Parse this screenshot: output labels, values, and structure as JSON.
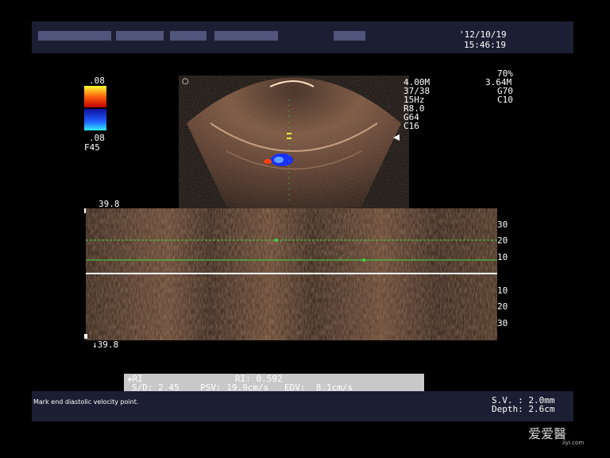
{
  "header": {
    "date": "'12/10/19",
    "time": "15:46:19",
    "redacted_label": "patient info (blurred)"
  },
  "color_scale": {
    "top": ".08",
    "bottom": ".08",
    "filter": "F45"
  },
  "params_left": {
    "freq": "4.00M",
    "gain_ratio": "37/38",
    "prf": "15Hz",
    "r": "R8.0",
    "g": "G64",
    "c": "C16"
  },
  "params_right": {
    "power": "70%",
    "freq": "3.64M",
    "gain": "G70",
    "c": "C10"
  },
  "spectral": {
    "top_scale": "39.8",
    "bottom_scale": "↓39.8",
    "ticks_top": [
      "30",
      "20",
      "10"
    ],
    "ticks_bottom": [
      "10",
      "20",
      "30"
    ]
  },
  "measurements": {
    "line1_left": "✚RI",
    "line1_right": "RI: 0.592",
    "line2": "S/D: 2.45    PSV: 19.9cm/s   EDV:  8.1cm/s"
  },
  "status": {
    "message": "Mark end diastolic velocity point.",
    "sv": "S.V. : 2.0mm",
    "depth": "Depth: 2.6cm"
  },
  "watermark": {
    "text": "爱爱醫",
    "sub": "iiyi.com"
  },
  "colors": {
    "panel": "#1c1f33",
    "green_line": "#3fdc3f",
    "tissue": "#8a5a3c"
  }
}
